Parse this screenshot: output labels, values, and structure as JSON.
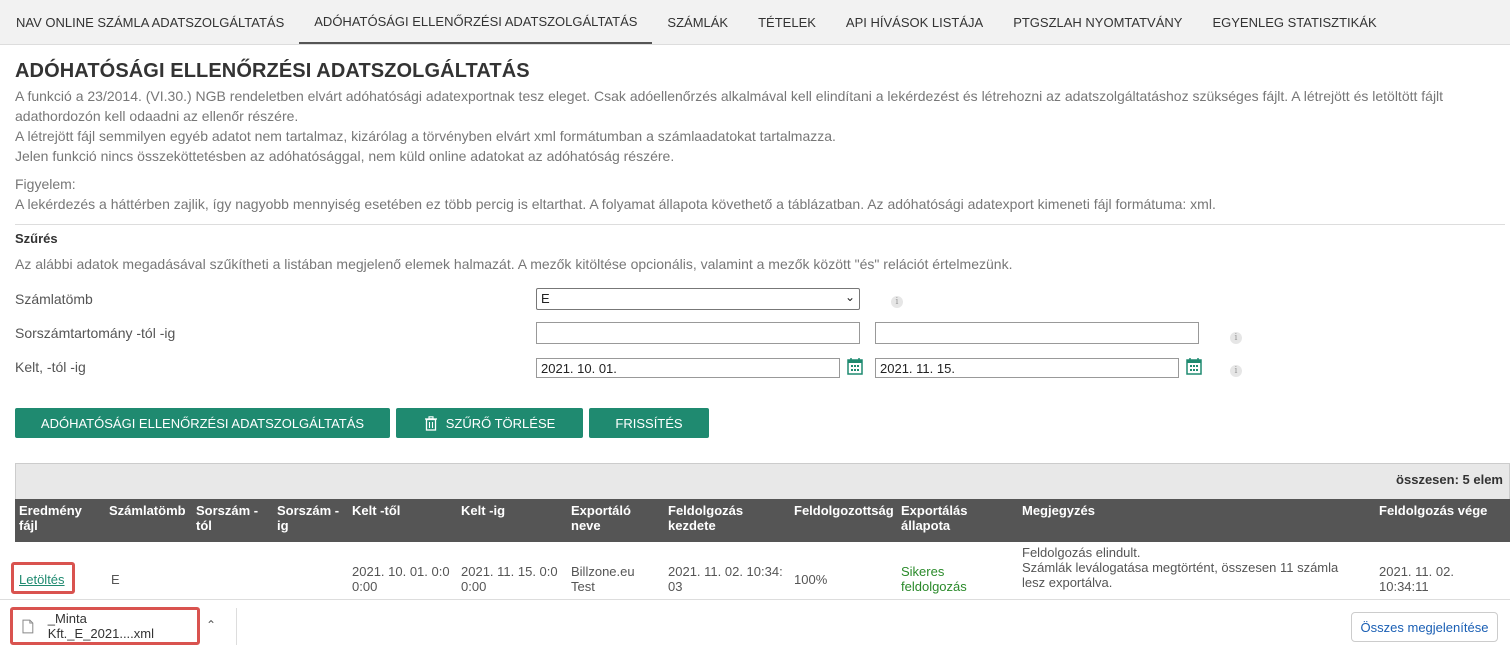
{
  "nav": {
    "tabs": [
      {
        "label": "NAV ONLINE SZÁMLA ADATSZOLGÁLTATÁS"
      },
      {
        "label": "ADÓHATÓSÁGI ELLENŐRZÉSI ADATSZOLGÁLTATÁS"
      },
      {
        "label": "SZÁMLÁK"
      },
      {
        "label": "TÉTELEK"
      },
      {
        "label": "API HÍVÁSOK LISTÁJA"
      },
      {
        "label": "PTGSZLAH NYOMTATVÁNY"
      },
      {
        "label": "EGYENLEG STATISZTIKÁK"
      }
    ],
    "active_index": 1
  },
  "page": {
    "title": "ADÓHATÓSÁGI ELLENŐRZÉSI ADATSZOLGÁLTATÁS",
    "desc1": "A funkció a 23/2014. (VI.30.) NGB rendeletben elvárt adóhatósági adatexportnak tesz eleget. Csak adóellenőrzés alkalmával kell elindítani a lekérdezést és létrehozni az adatszolgáltatáshoz szükséges fájlt. A létrejött és letöltött fájlt",
    "desc2": "adathordozón kell odaadni az ellenőr részére.",
    "desc3": "A létrejött fájl semmilyen egyéb adatot nem tartalmaz, kizárólag a törvényben elvárt xml formátumban a számlaadatokat tartalmazza.",
    "desc4": "Jelen funkció nincs összeköttetésben az adóhatósággal, nem küld online adatokat az adóhatóság részére.",
    "warning_label": "Figyelem:",
    "warning_text": "A lekérdezés a háttérben zajlik, így nagyobb mennyiség esetében ez több percig is eltarthat. A folyamat állapota követhető a táblázatban. Az adóhatósági adatexport kimeneti fájl formátuma: xml."
  },
  "filter": {
    "title": "Szűrés",
    "desc": "Az alábbi adatok megadásával szűkítheti a listában megjelenő elemek halmazát. A mezők kitöltése opcionális, valamint a mezők között \"és\" relációt értelmezünk.",
    "szamlatomb_label": "Számlatömb",
    "szamlatomb_value": "E",
    "sorszam_label": "Sorszámtartomány -tól -ig",
    "sorszam_from": "",
    "sorszam_to": "",
    "kelt_label": "Kelt, -tól -ig",
    "kelt_from": "2021. 10. 01.",
    "kelt_to": "2021. 11. 15."
  },
  "buttons": {
    "export": "ADÓHATÓSÁGI ELLENŐRZÉSI ADATSZOLGÁLTATÁS",
    "clear": "SZŰRŐ TÖRLÉSE",
    "refresh": "FRISSÍTÉS"
  },
  "table": {
    "total": "összesen: 5 elem",
    "headers": {
      "file1": "Eredmény",
      "file2": "fájl",
      "block": "Számlatömb",
      "from1": "Sorszám -",
      "from2": "tól",
      "to1": "Sorszám -",
      "to2": "ig",
      "kelt_from": "Kelt -től",
      "kelt_to": "Kelt -ig",
      "exporter1": "Exportáló",
      "exporter2": "neve",
      "start1": "Feldolgozás",
      "start2": "kezdete",
      "progress": "Feldolgozottság",
      "status1": "Exportálás",
      "status2": "állapota",
      "note": "Megjegyzés",
      "end": "Feldolgozás vége"
    },
    "row": {
      "file": "Letöltés",
      "block": "E",
      "kelt_from1": "2021. 10. 01. 0:0",
      "kelt_from2": "0:00",
      "kelt_to1": "2021. 11. 15. 0:0",
      "kelt_to2": "0:00",
      "exporter1": "Billzone.eu",
      "exporter2": "Test",
      "start1": "2021. 11. 02. 10:34:",
      "start2": "03",
      "progress": "100%",
      "status1": "Sikeres",
      "status2": "feldolgozás",
      "note1": "Feldolgozás elindult.",
      "note2": "Számlák leválogatása megtörtént, összesen 11 számla",
      "note3": "lesz exportálva.",
      "end1": "2021. 11. 02.",
      "end2": "10:34:11"
    }
  },
  "download_bar": {
    "filename": "_Minta Kft._E_2021....xml",
    "show_all": "Összes megjelenítése"
  },
  "colors": {
    "accent": "#1f8a70",
    "highlight": "#d9534f",
    "header_bg": "#555555"
  }
}
